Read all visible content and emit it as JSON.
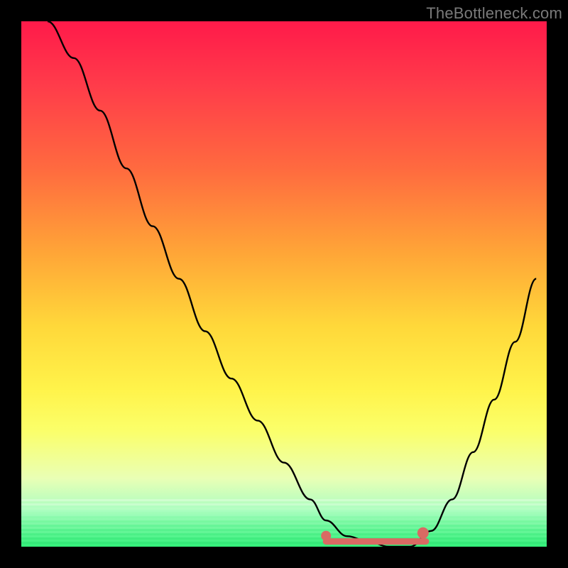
{
  "attribution": "TheBottleneck.com",
  "colors": {
    "frame": "#000000",
    "curve": "#000000",
    "marker": "#d96a63",
    "gradient_top": "#ff1a4a",
    "gradient_mid": "#ffd83a",
    "gradient_bottom": "#33f07a"
  },
  "chart_data": {
    "type": "line",
    "title": "",
    "xlabel": "",
    "ylabel": "",
    "xlim": [
      0,
      100
    ],
    "ylim": [
      0,
      100
    ],
    "grid": false,
    "legend": false,
    "series": [
      {
        "name": "bottleneck-curve",
        "x": [
          5,
          10,
          15,
          20,
          25,
          30,
          35,
          40,
          45,
          50,
          55,
          58,
          62,
          66,
          70,
          74,
          78,
          82,
          86,
          90,
          94,
          98
        ],
        "y": [
          100,
          93,
          83,
          72,
          61,
          51,
          41,
          32,
          24,
          16,
          9,
          5,
          2,
          1,
          0,
          0,
          3,
          9,
          18,
          28,
          39,
          51
        ]
      }
    ],
    "flat_region": {
      "x_start": 58,
      "x_end": 77,
      "y": 1
    },
    "annotations": []
  }
}
